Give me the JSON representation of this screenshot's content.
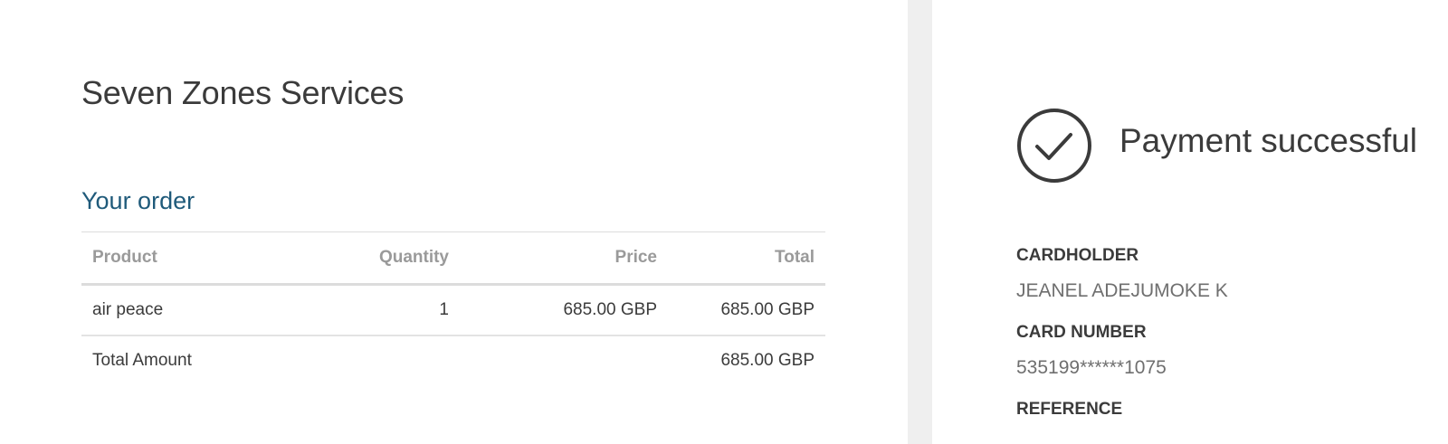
{
  "merchant": {
    "name": "Seven Zones Services"
  },
  "order": {
    "heading": "Your order",
    "columns": {
      "product": "Product",
      "quantity": "Quantity",
      "price": "Price",
      "total": "Total"
    },
    "items": [
      {
        "product": "air peace",
        "quantity": "1",
        "price": "685.00 GBP",
        "total": "685.00 GBP"
      }
    ],
    "total_label": "Total Amount",
    "total_value": "685.00 GBP"
  },
  "payment": {
    "status_icon": "check-circle-icon",
    "title": "Payment successful",
    "cardholder_label": "CARDHOLDER",
    "cardholder_value": "JEANEL ADEJUMOKE K",
    "card_number_label": "CARD NUMBER",
    "card_number_value": "535199******1075",
    "reference_label": "REFERENCE"
  },
  "colors": {
    "heading_accent": "#1f5a7a",
    "text_primary": "#3b3b3b",
    "text_muted": "#9a9a9a",
    "divider": "#efefef"
  }
}
